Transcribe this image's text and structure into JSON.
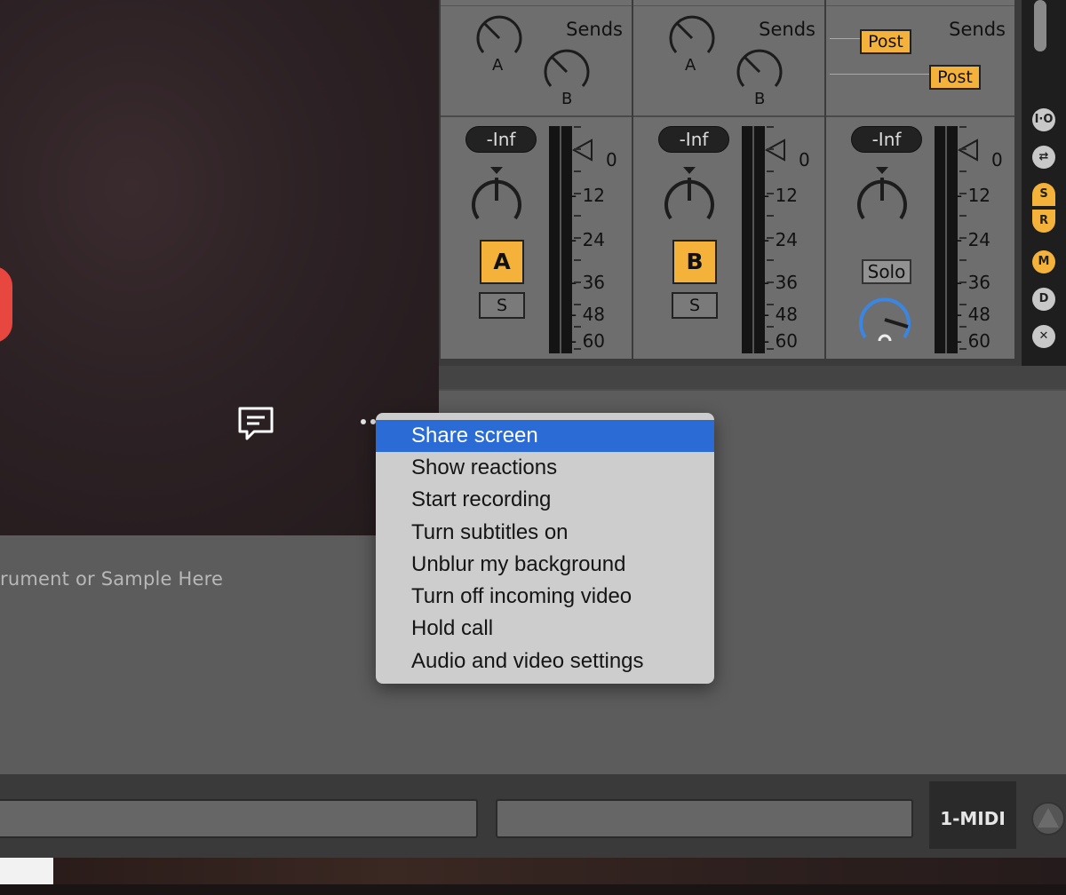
{
  "mixer": {
    "sends_title": "Sends",
    "tracks": [
      {
        "send_a": "A",
        "send_b": "B",
        "volume": "-Inf",
        "button": "A",
        "solo": "S"
      },
      {
        "send_a": "A",
        "send_b": "B",
        "volume": "-Inf",
        "button": "B",
        "solo": "S"
      },
      {
        "post_a": "Post",
        "post_b": "Post",
        "volume": "-Inf",
        "solo": "Solo"
      }
    ],
    "scale": [
      "0",
      "12",
      "24",
      "36",
      "48",
      "60"
    ],
    "side_buttons": [
      "I·O",
      "⇄",
      "S",
      "R",
      "M",
      "D",
      "✕"
    ]
  },
  "device": {
    "drop_text": "rument or Sample Here"
  },
  "bottom": {
    "track_name": "1-MIDI"
  },
  "menu": {
    "items": [
      "Share screen",
      "Show reactions",
      "Start recording",
      "Turn subtitles on",
      "Unblur my background",
      "Turn off incoming video",
      "Hold call",
      "Audio and video settings"
    ]
  },
  "colors": {
    "accent": "#f5b23b",
    "menu_highlight": "#2b6bd6",
    "record": "#e8473f"
  }
}
